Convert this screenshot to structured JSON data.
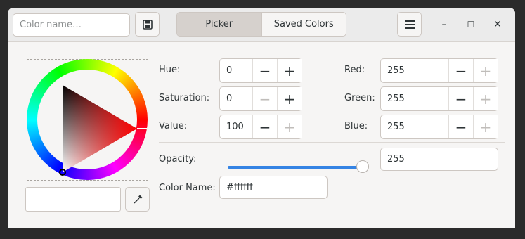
{
  "header": {
    "color_name_placeholder": "Color name…",
    "save_icon": "save-icon",
    "tabs": [
      {
        "label": "Picker",
        "active": true
      },
      {
        "label": "Saved Colors",
        "active": false
      }
    ],
    "menu_icon": "hamburger-menu-icon",
    "window_controls": {
      "minimize": "–",
      "maximize": "☐",
      "close": "✕"
    }
  },
  "picker": {
    "hue": {
      "label": "Hue:",
      "value": "0",
      "dec": "−",
      "inc": "+"
    },
    "saturation": {
      "label": "Saturation:",
      "value": "0",
      "dec": "−",
      "inc": "+"
    },
    "value": {
      "label": "Value:",
      "value": "100",
      "dec": "−",
      "inc": "+"
    },
    "red": {
      "label": "Red:",
      "value": "255",
      "dec": "−",
      "inc": "+"
    },
    "green": {
      "label": "Green:",
      "value": "255",
      "dec": "−",
      "inc": "+"
    },
    "blue": {
      "label": "Blue:",
      "value": "255",
      "dec": "−",
      "inc": "+"
    },
    "opacity": {
      "label": "Opacity:",
      "value": "255",
      "slider_fraction": 1.0
    },
    "color_name": {
      "label": "Color Name:",
      "value": "#ffffff"
    },
    "eyedropper_icon": "eyedropper-icon",
    "preview_color": "#ffffff"
  },
  "colors": {
    "accent": "#3584e4",
    "window_bg": "#f6f5f4",
    "header_bg": "#ebebeb"
  }
}
